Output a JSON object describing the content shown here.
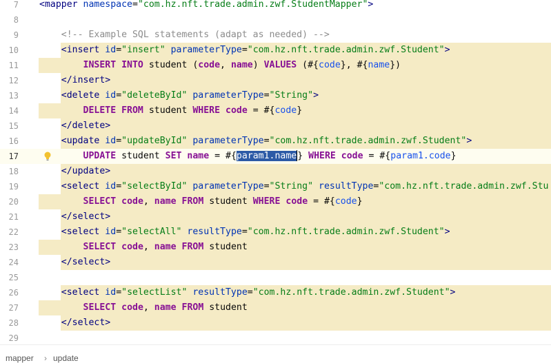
{
  "editor": {
    "lines": [
      {
        "no": "7",
        "tokens": [
          [
            "tag",
            "<mapper "
          ],
          [
            "attr",
            "namespace"
          ],
          [
            "plain",
            "="
          ],
          [
            "val",
            "\"com.hz.nft.trade.admin.zwf.StudentMapper\""
          ],
          [
            "tag",
            ">"
          ]
        ]
      },
      {
        "no": "8",
        "tokens": []
      },
      {
        "no": "9",
        "tokens": [
          [
            "plain",
            "    "
          ],
          [
            "cmt",
            "<!-- Example SQL statements (adapt as needed) -->"
          ]
        ]
      },
      {
        "no": "10",
        "tokens": [
          [
            "plain",
            "    "
          ],
          [
            "tag",
            "<insert "
          ],
          [
            "attr",
            "id"
          ],
          [
            "plain",
            "="
          ],
          [
            "val",
            "\"insert\" "
          ],
          [
            "attr",
            "parameterType"
          ],
          [
            "plain",
            "="
          ],
          [
            "val",
            "\"com.hz.nft.trade.admin.zwf.Student\""
          ],
          [
            "tag",
            ">"
          ]
        ]
      },
      {
        "no": "11",
        "tokens": [
          [
            "plain",
            "        "
          ],
          [
            "kw",
            "INSERT INTO"
          ],
          [
            "plain",
            " student ("
          ],
          [
            "kw",
            "code"
          ],
          [
            "plain",
            ", "
          ],
          [
            "kw",
            "name"
          ],
          [
            "plain",
            ") "
          ],
          [
            "kw",
            "VALUES"
          ],
          [
            "plain",
            " (#{"
          ],
          [
            "param",
            "code"
          ],
          [
            "plain",
            "}, #{"
          ],
          [
            "param",
            "name"
          ],
          [
            "plain",
            "})"
          ]
        ]
      },
      {
        "no": "12",
        "tokens": [
          [
            "plain",
            "    "
          ],
          [
            "tag",
            "</insert>"
          ]
        ]
      },
      {
        "no": "13",
        "tokens": [
          [
            "plain",
            "    "
          ],
          [
            "tag",
            "<delete "
          ],
          [
            "attr",
            "id"
          ],
          [
            "plain",
            "="
          ],
          [
            "val",
            "\"deleteById\" "
          ],
          [
            "attr",
            "parameterType"
          ],
          [
            "plain",
            "="
          ],
          [
            "val",
            "\"String\""
          ],
          [
            "tag",
            ">"
          ]
        ]
      },
      {
        "no": "14",
        "tokens": [
          [
            "plain",
            "        "
          ],
          [
            "kw",
            "DELETE FROM"
          ],
          [
            "plain",
            " student "
          ],
          [
            "kw",
            "WHERE"
          ],
          [
            "plain",
            " "
          ],
          [
            "kw",
            "code"
          ],
          [
            "plain",
            " = #{"
          ],
          [
            "param",
            "code"
          ],
          [
            "plain",
            "}"
          ]
        ]
      },
      {
        "no": "15",
        "tokens": [
          [
            "plain",
            "    "
          ],
          [
            "tag",
            "</delete>"
          ]
        ]
      },
      {
        "no": "16",
        "tokens": [
          [
            "plain",
            "    "
          ],
          [
            "tag",
            "<update "
          ],
          [
            "attr",
            "id"
          ],
          [
            "plain",
            "="
          ],
          [
            "val",
            "\"updateById\" "
          ],
          [
            "attr",
            "parameterType"
          ],
          [
            "plain",
            "="
          ],
          [
            "val",
            "\"com.hz.nft.trade.admin.zwf.Student\""
          ],
          [
            "tag",
            ">"
          ]
        ]
      },
      {
        "no": "17",
        "tokens": [
          [
            "plain",
            "        "
          ],
          [
            "kw",
            "UPDATE"
          ],
          [
            "plain",
            " student "
          ],
          [
            "kw",
            "SET"
          ],
          [
            "plain",
            " "
          ],
          [
            "kw",
            "name"
          ],
          [
            "plain",
            " = #{"
          ],
          [
            "sel",
            "param1.name"
          ],
          [
            "caret",
            ""
          ],
          [
            "plain",
            "} "
          ],
          [
            "kw",
            "WHERE"
          ],
          [
            "plain",
            " "
          ],
          [
            "kw",
            "code"
          ],
          [
            "plain",
            " = #{"
          ],
          [
            "param",
            "param1.code"
          ],
          [
            "plain",
            "}"
          ]
        ]
      },
      {
        "no": "18",
        "tokens": [
          [
            "plain",
            "    "
          ],
          [
            "tag",
            "</update>"
          ]
        ]
      },
      {
        "no": "19",
        "tokens": [
          [
            "plain",
            "    "
          ],
          [
            "tag",
            "<select "
          ],
          [
            "attr",
            "id"
          ],
          [
            "plain",
            "="
          ],
          [
            "val",
            "\"selectById\" "
          ],
          [
            "attr",
            "parameterType"
          ],
          [
            "plain",
            "="
          ],
          [
            "val",
            "\"String\" "
          ],
          [
            "attr",
            "resultType"
          ],
          [
            "plain",
            "="
          ],
          [
            "val",
            "\"com.hz.nft.trade.admin.zwf.Stu"
          ]
        ]
      },
      {
        "no": "20",
        "tokens": [
          [
            "plain",
            "        "
          ],
          [
            "kw",
            "SELECT"
          ],
          [
            "plain",
            " "
          ],
          [
            "kw",
            "code"
          ],
          [
            "plain",
            ", "
          ],
          [
            "kw",
            "name"
          ],
          [
            "plain",
            " "
          ],
          [
            "kw",
            "FROM"
          ],
          [
            "plain",
            " student "
          ],
          [
            "kw",
            "WHERE"
          ],
          [
            "plain",
            " "
          ],
          [
            "kw",
            "code"
          ],
          [
            "plain",
            " = #{"
          ],
          [
            "param",
            "code"
          ],
          [
            "plain",
            "}"
          ]
        ]
      },
      {
        "no": "21",
        "tokens": [
          [
            "plain",
            "    "
          ],
          [
            "tag",
            "</select>"
          ]
        ]
      },
      {
        "no": "22",
        "tokens": [
          [
            "plain",
            "    "
          ],
          [
            "tag",
            "<select "
          ],
          [
            "attr",
            "id"
          ],
          [
            "plain",
            "="
          ],
          [
            "val",
            "\"selectAll\" "
          ],
          [
            "attr",
            "resultType"
          ],
          [
            "plain",
            "="
          ],
          [
            "val",
            "\"com.hz.nft.trade.admin.zwf.Student\""
          ],
          [
            "tag",
            ">"
          ]
        ]
      },
      {
        "no": "23",
        "tokens": [
          [
            "plain",
            "        "
          ],
          [
            "kw",
            "SELECT"
          ],
          [
            "plain",
            " "
          ],
          [
            "kw",
            "code"
          ],
          [
            "plain",
            ", "
          ],
          [
            "kw",
            "name"
          ],
          [
            "plain",
            " "
          ],
          [
            "kw",
            "FROM"
          ],
          [
            "plain",
            " student"
          ]
        ]
      },
      {
        "no": "24",
        "tokens": [
          [
            "plain",
            "    "
          ],
          [
            "tag",
            "</select>"
          ]
        ]
      },
      {
        "no": "25",
        "tokens": []
      },
      {
        "no": "26",
        "tokens": [
          [
            "plain",
            "    "
          ],
          [
            "tag",
            "<select "
          ],
          [
            "attr",
            "id"
          ],
          [
            "plain",
            "="
          ],
          [
            "val",
            "\"selectList\" "
          ],
          [
            "attr",
            "resultType"
          ],
          [
            "plain",
            "="
          ],
          [
            "val",
            "\"com.hz.nft.trade.admin.zwf.Student\""
          ],
          [
            "tag",
            ">"
          ]
        ]
      },
      {
        "no": "27",
        "tokens": [
          [
            "plain",
            "        "
          ],
          [
            "kw",
            "SELECT"
          ],
          [
            "plain",
            " "
          ],
          [
            "kw",
            "code"
          ],
          [
            "plain",
            ", "
          ],
          [
            "kw",
            "name"
          ],
          [
            "plain",
            " "
          ],
          [
            "kw",
            "FROM"
          ],
          [
            "plain",
            " student"
          ]
        ]
      },
      {
        "no": "28",
        "tokens": [
          [
            "plain",
            "    "
          ],
          [
            "tag",
            "</select>"
          ]
        ]
      },
      {
        "no": "29",
        "tokens": []
      }
    ],
    "current_line": "17",
    "highlight_outer": [
      "10",
      "11",
      "12",
      "13",
      "14",
      "15",
      "16",
      "17",
      "18",
      "19",
      "20",
      "21",
      "22",
      "23",
      "24",
      "26",
      "27",
      "28"
    ],
    "highlight_lines_outer_indent": [
      "10",
      "12",
      "13",
      "15",
      "16",
      "18",
      "19",
      "21",
      "22",
      "24",
      "26",
      "28"
    ],
    "intention_icon": "lightbulb-icon"
  },
  "breadcrumb": {
    "items": [
      "mapper",
      "update"
    ],
    "separator": "›"
  },
  "colors": {
    "highlight": "#f5ebc5",
    "selection": "#2c5aa6",
    "tag": "#000080",
    "attribute": "#0033b3",
    "value": "#067d17",
    "keyword": "#871094"
  }
}
